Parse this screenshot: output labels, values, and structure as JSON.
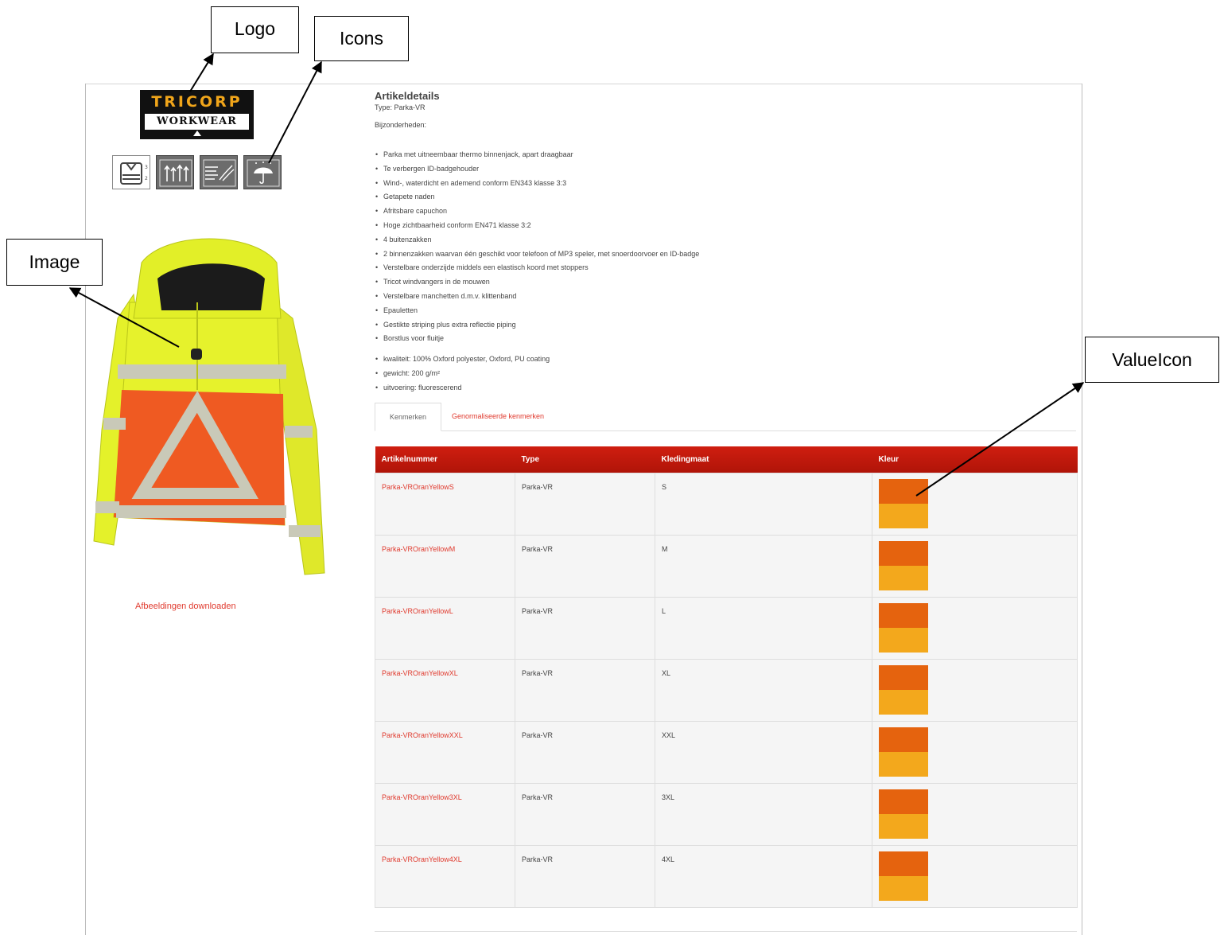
{
  "callouts": {
    "logo": "Logo",
    "icons": "Icons",
    "image": "Image",
    "value_icon": "ValueIcon"
  },
  "logo": {
    "line1": "TRICORP",
    "line2": "WORKWEAR"
  },
  "icon_names": [
    "hi-vis-vest-icon",
    "breathable-icon",
    "windproof-icon",
    "waterproof-umbrella-icon"
  ],
  "download_link": "Afbeeldingen downloaden",
  "details": {
    "title": "Artikeldetails",
    "type": "Type: Parka-VR",
    "bijzonderheden": "Bijzonderheden:"
  },
  "features": [
    "Parka met uitneembaar thermo binnenjack, apart draagbaar",
    "Te verbergen ID-badgehouder",
    "Wind-, waterdicht en ademend conform EN343 klasse 3:3",
    "Getapete naden",
    "Afritsbare capuchon",
    "Hoge zichtbaarheid conform EN471 klasse 3:2",
    "4 buitenzakken",
    "2 binnenzakken waarvan één geschikt voor telefoon of MP3 speler, met snoerdoorvoer en ID-badge",
    "Verstelbare onderzijde middels een elastisch koord met stoppers",
    "Tricot windvangers in de mouwen",
    "Verstelbare manchetten d.m.v. klittenband",
    "Epauletten",
    "Gestikte striping plus extra reflectie piping",
    "Borstlus voor fluitje"
  ],
  "specs": [
    "kwaliteit: 100% Oxford polyester, Oxford, PU coating",
    "gewicht: 200 g/m²",
    "uitvoering: fluorescerend"
  ],
  "tabs": {
    "active": "Kenmerken",
    "other": "Genormaliseerde kenmerken"
  },
  "table": {
    "headers": [
      "Artikelnummer",
      "Type",
      "Kledingmaat",
      "Kleur"
    ],
    "rows": [
      {
        "art": "Parka-VROranYellowS",
        "type": "Parka-VR",
        "size": "S"
      },
      {
        "art": "Parka-VROranYellowM",
        "type": "Parka-VR",
        "size": "M"
      },
      {
        "art": "Parka-VROranYellowL",
        "type": "Parka-VR",
        "size": "L"
      },
      {
        "art": "Parka-VROranYellowXL",
        "type": "Parka-VR",
        "size": "XL"
      },
      {
        "art": "Parka-VROranYellowXXL",
        "type": "Parka-VR",
        "size": "XXL"
      },
      {
        "art": "Parka-VROranYellow3XL",
        "type": "Parka-VR",
        "size": "3XL"
      },
      {
        "art": "Parka-VROranYellow4XL",
        "type": "Parka-VR",
        "size": "4XL"
      }
    ],
    "swatch_colors": [
      "#e5630e",
      "#f3a81c"
    ]
  },
  "colors": {
    "accent": "#e03a2e",
    "header_red": "#c41a0c",
    "jacket_yellow": "#e4f12a",
    "jacket_orange": "#ef5a22"
  }
}
